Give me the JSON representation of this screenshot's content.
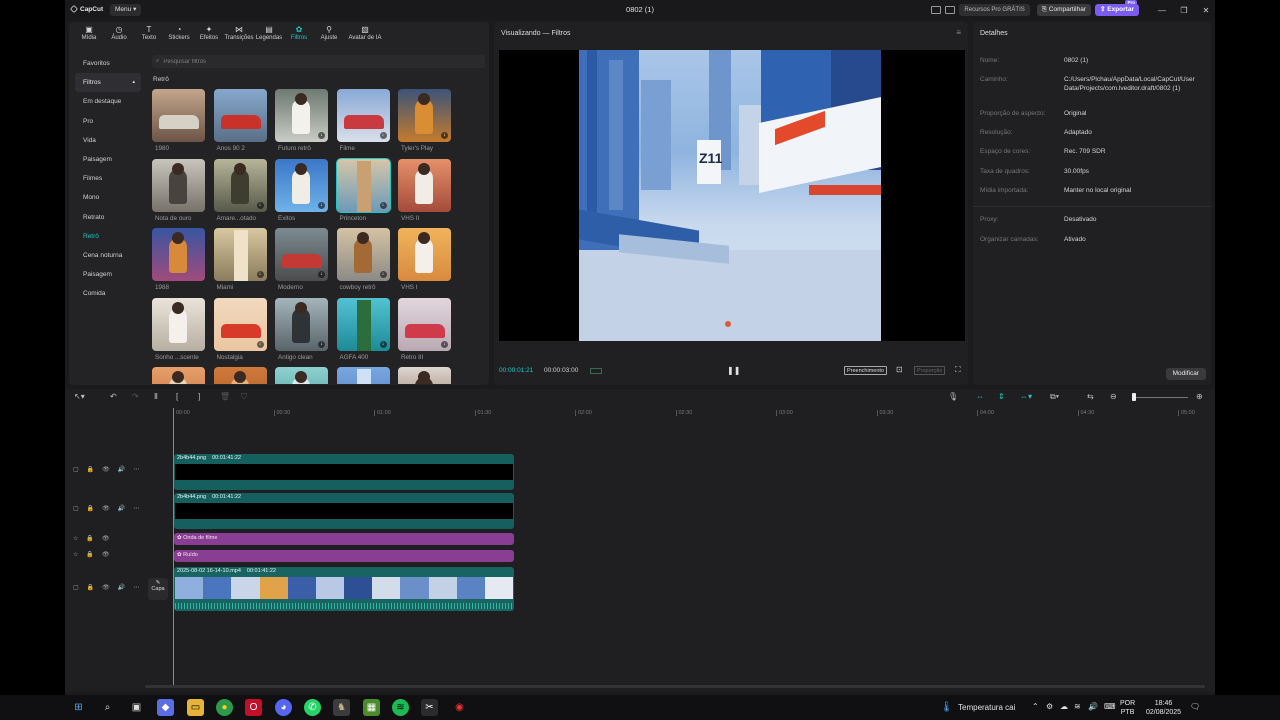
{
  "app": {
    "logo": "CapCut",
    "menu": "Menu",
    "title": "0802 (1)",
    "pro_resources": "Recursos Pro GRÁTIS",
    "share": "Compartilhar",
    "export": "Exportar",
    "export_tag": "Pro"
  },
  "tabs": [
    {
      "label": "Mídia",
      "icon": "media-icon"
    },
    {
      "label": "Áudio",
      "icon": "audio-icon"
    },
    {
      "label": "Texto",
      "icon": "text-icon"
    },
    {
      "label": "Stickers",
      "icon": "sticker-icon"
    },
    {
      "label": "Efeitos",
      "icon": "effects-icon"
    },
    {
      "label": "Transições",
      "icon": "transitions-icon"
    },
    {
      "label": "Legendas",
      "icon": "captions-icon"
    },
    {
      "label": "Filtros",
      "icon": "filters-icon"
    },
    {
      "label": "Ajuste",
      "icon": "adjust-icon"
    },
    {
      "label": "Avatar de IA",
      "icon": "ai-avatar-icon"
    }
  ],
  "categories": [
    "Favoritos",
    "Filtros",
    "Em destaque",
    "Pro",
    "Vida",
    "Paisagem",
    "Filmes",
    "Mono",
    "Retrato",
    "Retrô",
    "Cena noturna",
    "Paisagem",
    "Comida"
  ],
  "search_placeholder": "Pesquisar filtros",
  "section_title": "Retrô",
  "filters": [
    {
      "label": "1980"
    },
    {
      "label": "Anos 90 2"
    },
    {
      "label": "Futuro retrô"
    },
    {
      "label": "Filme"
    },
    {
      "label": "Tyler's Play"
    },
    {
      "label": "Nota de ouro"
    },
    {
      "label": "Amare...otado"
    },
    {
      "label": "Êxitos"
    },
    {
      "label": "Princeton"
    },
    {
      "label": "VHS II"
    },
    {
      "label": "1988"
    },
    {
      "label": "Miami"
    },
    {
      "label": "Moderno"
    },
    {
      "label": "cowboy retrô"
    },
    {
      "label": "VHS I"
    },
    {
      "label": "Sonho ...scente"
    },
    {
      "label": "Nostalgia"
    },
    {
      "label": "Antigo clean"
    },
    {
      "label": "AGFA 400"
    },
    {
      "label": "Retro III"
    },
    {
      "label": ""
    },
    {
      "label": ""
    },
    {
      "label": ""
    },
    {
      "label": ""
    },
    {
      "label": ""
    }
  ],
  "player": {
    "title": "Visualizando — Filtros",
    "current": "00:00:01:21",
    "total": "00:00:03:00",
    "fill": "Preenchimento",
    "proportion": "Proporção",
    "frame_sign": "Z11"
  },
  "details": {
    "title": "Detalhes",
    "rows": [
      {
        "key": "Nome:",
        "value": "0802 (1)"
      },
      {
        "key": "Caminho:",
        "value": "C:/Users/Plchau/AppData/Local/CapCut/User Data/Projects/com.lveditor.draft/0802 (1)"
      },
      {
        "key": "Proporção de aspecto:",
        "value": "Original"
      },
      {
        "key": "Resolução:",
        "value": "Adaptado"
      },
      {
        "key": "Espaço de cores:",
        "value": "Rec. 709 SDR"
      },
      {
        "key": "Taxa de quadros:",
        "value": "30.00fps"
      },
      {
        "key": "Mídia importada:",
        "value": "Manter no local original"
      },
      {
        "key": "Proxy:",
        "value": "Desativado"
      },
      {
        "key": "Organizar camadas:",
        "value": "Ativado"
      }
    ],
    "modify": "Modificar"
  },
  "timeline": {
    "ticks": [
      "00:00",
      "00:30",
      "01:00",
      "01:30",
      "02:00",
      "02:30",
      "03:00",
      "03:30",
      "04:00",
      "04:30",
      "05:00"
    ],
    "clips": [
      {
        "name": "2b4b44.png",
        "duration": "00:01:41:22"
      },
      {
        "name": "2b4b44.png",
        "duration": "00:01:41:22"
      },
      {
        "name": "Onda de filme",
        "duration": ""
      },
      {
        "name": "Ruído",
        "duration": ""
      },
      {
        "name": "2025-08-02 16-14-10.mp4",
        "duration": "00:01:41:22"
      }
    ],
    "cover": "Capa"
  },
  "taskbar": {
    "weather": "Temperatura cai",
    "lang1": "POR",
    "lang2": "PTB",
    "time": "18:46",
    "date": "02/08/2025"
  }
}
